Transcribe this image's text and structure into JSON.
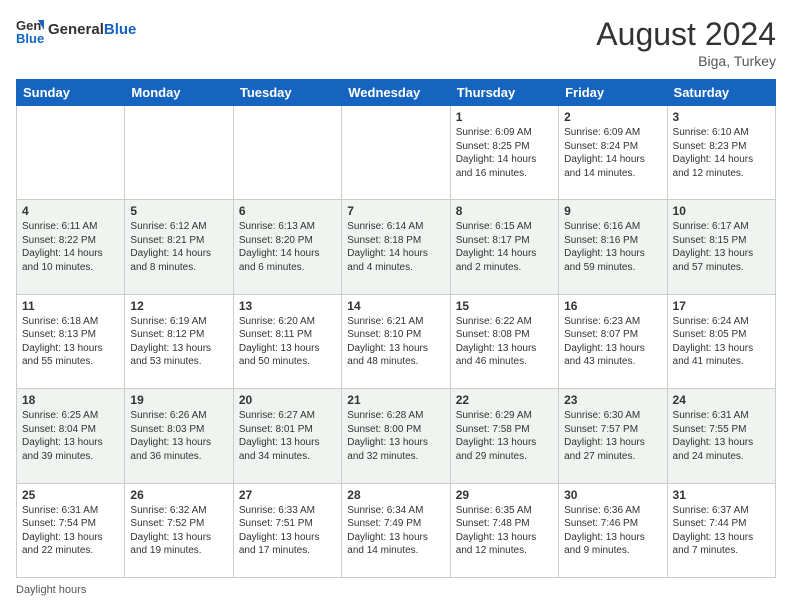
{
  "header": {
    "logo_general": "General",
    "logo_blue": "Blue",
    "month_year": "August 2024",
    "location": "Biga, Turkey"
  },
  "days_of_week": [
    "Sunday",
    "Monday",
    "Tuesday",
    "Wednesday",
    "Thursday",
    "Friday",
    "Saturday"
  ],
  "weeks": [
    [
      {
        "day": "",
        "info": ""
      },
      {
        "day": "",
        "info": ""
      },
      {
        "day": "",
        "info": ""
      },
      {
        "day": "",
        "info": ""
      },
      {
        "day": "1",
        "info": "Sunrise: 6:09 AM\nSunset: 8:25 PM\nDaylight: 14 hours and 16 minutes."
      },
      {
        "day": "2",
        "info": "Sunrise: 6:09 AM\nSunset: 8:24 PM\nDaylight: 14 hours and 14 minutes."
      },
      {
        "day": "3",
        "info": "Sunrise: 6:10 AM\nSunset: 8:23 PM\nDaylight: 14 hours and 12 minutes."
      }
    ],
    [
      {
        "day": "4",
        "info": "Sunrise: 6:11 AM\nSunset: 8:22 PM\nDaylight: 14 hours and 10 minutes."
      },
      {
        "day": "5",
        "info": "Sunrise: 6:12 AM\nSunset: 8:21 PM\nDaylight: 14 hours and 8 minutes."
      },
      {
        "day": "6",
        "info": "Sunrise: 6:13 AM\nSunset: 8:20 PM\nDaylight: 14 hours and 6 minutes."
      },
      {
        "day": "7",
        "info": "Sunrise: 6:14 AM\nSunset: 8:18 PM\nDaylight: 14 hours and 4 minutes."
      },
      {
        "day": "8",
        "info": "Sunrise: 6:15 AM\nSunset: 8:17 PM\nDaylight: 14 hours and 2 minutes."
      },
      {
        "day": "9",
        "info": "Sunrise: 6:16 AM\nSunset: 8:16 PM\nDaylight: 13 hours and 59 minutes."
      },
      {
        "day": "10",
        "info": "Sunrise: 6:17 AM\nSunset: 8:15 PM\nDaylight: 13 hours and 57 minutes."
      }
    ],
    [
      {
        "day": "11",
        "info": "Sunrise: 6:18 AM\nSunset: 8:13 PM\nDaylight: 13 hours and 55 minutes."
      },
      {
        "day": "12",
        "info": "Sunrise: 6:19 AM\nSunset: 8:12 PM\nDaylight: 13 hours and 53 minutes."
      },
      {
        "day": "13",
        "info": "Sunrise: 6:20 AM\nSunset: 8:11 PM\nDaylight: 13 hours and 50 minutes."
      },
      {
        "day": "14",
        "info": "Sunrise: 6:21 AM\nSunset: 8:10 PM\nDaylight: 13 hours and 48 minutes."
      },
      {
        "day": "15",
        "info": "Sunrise: 6:22 AM\nSunset: 8:08 PM\nDaylight: 13 hours and 46 minutes."
      },
      {
        "day": "16",
        "info": "Sunrise: 6:23 AM\nSunset: 8:07 PM\nDaylight: 13 hours and 43 minutes."
      },
      {
        "day": "17",
        "info": "Sunrise: 6:24 AM\nSunset: 8:05 PM\nDaylight: 13 hours and 41 minutes."
      }
    ],
    [
      {
        "day": "18",
        "info": "Sunrise: 6:25 AM\nSunset: 8:04 PM\nDaylight: 13 hours and 39 minutes."
      },
      {
        "day": "19",
        "info": "Sunrise: 6:26 AM\nSunset: 8:03 PM\nDaylight: 13 hours and 36 minutes."
      },
      {
        "day": "20",
        "info": "Sunrise: 6:27 AM\nSunset: 8:01 PM\nDaylight: 13 hours and 34 minutes."
      },
      {
        "day": "21",
        "info": "Sunrise: 6:28 AM\nSunset: 8:00 PM\nDaylight: 13 hours and 32 minutes."
      },
      {
        "day": "22",
        "info": "Sunrise: 6:29 AM\nSunset: 7:58 PM\nDaylight: 13 hours and 29 minutes."
      },
      {
        "day": "23",
        "info": "Sunrise: 6:30 AM\nSunset: 7:57 PM\nDaylight: 13 hours and 27 minutes."
      },
      {
        "day": "24",
        "info": "Sunrise: 6:31 AM\nSunset: 7:55 PM\nDaylight: 13 hours and 24 minutes."
      }
    ],
    [
      {
        "day": "25",
        "info": "Sunrise: 6:31 AM\nSunset: 7:54 PM\nDaylight: 13 hours and 22 minutes."
      },
      {
        "day": "26",
        "info": "Sunrise: 6:32 AM\nSunset: 7:52 PM\nDaylight: 13 hours and 19 minutes."
      },
      {
        "day": "27",
        "info": "Sunrise: 6:33 AM\nSunset: 7:51 PM\nDaylight: 13 hours and 17 minutes."
      },
      {
        "day": "28",
        "info": "Sunrise: 6:34 AM\nSunset: 7:49 PM\nDaylight: 13 hours and 14 minutes."
      },
      {
        "day": "29",
        "info": "Sunrise: 6:35 AM\nSunset: 7:48 PM\nDaylight: 13 hours and 12 minutes."
      },
      {
        "day": "30",
        "info": "Sunrise: 6:36 AM\nSunset: 7:46 PM\nDaylight: 13 hours and 9 minutes."
      },
      {
        "day": "31",
        "info": "Sunrise: 6:37 AM\nSunset: 7:44 PM\nDaylight: 13 hours and 7 minutes."
      }
    ]
  ],
  "footer": {
    "daylight_label": "Daylight hours"
  }
}
